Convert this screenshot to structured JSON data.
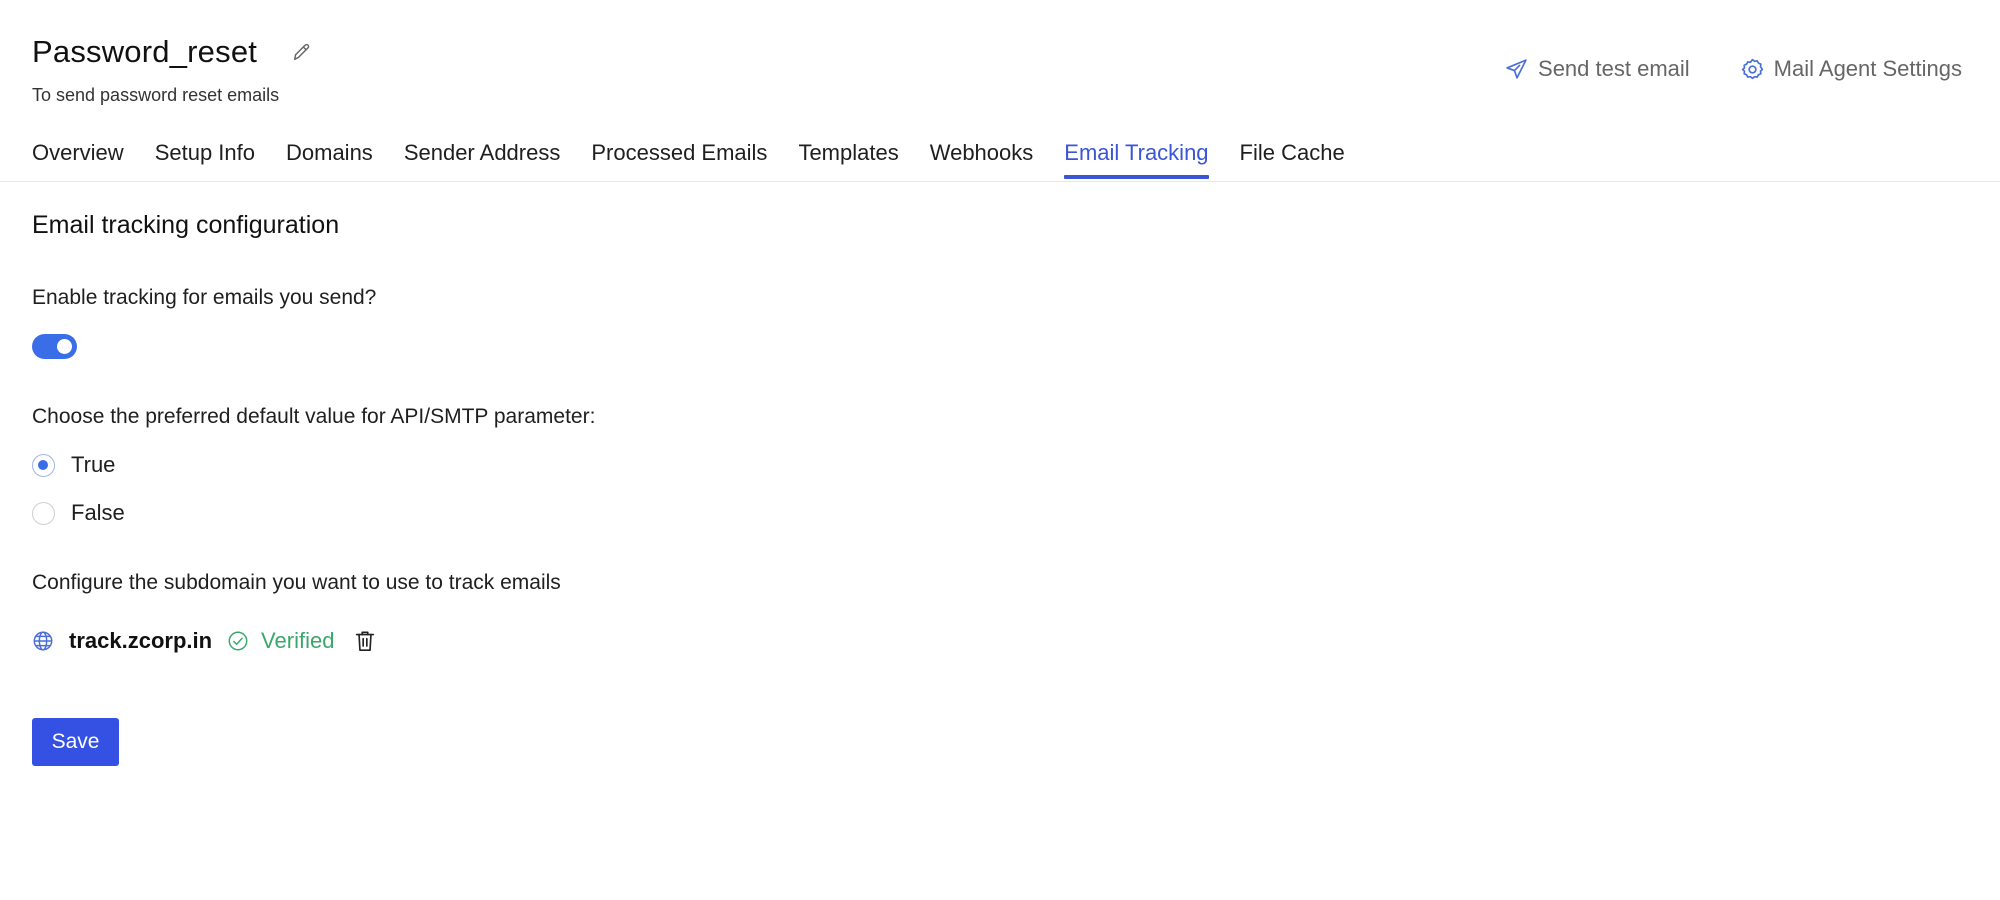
{
  "header": {
    "title": "Password_reset",
    "subtitle": "To send password reset emails",
    "actions": [
      {
        "label": "Send test email",
        "icon": "paper-plane-icon"
      },
      {
        "label": "Mail Agent Settings",
        "icon": "gear-icon"
      }
    ]
  },
  "tabs": [
    {
      "label": "Overview",
      "active": false
    },
    {
      "label": "Setup Info",
      "active": false
    },
    {
      "label": "Domains",
      "active": false
    },
    {
      "label": "Sender Address",
      "active": false
    },
    {
      "label": "Processed Emails",
      "active": false
    },
    {
      "label": "Templates",
      "active": false
    },
    {
      "label": "Webhooks",
      "active": false
    },
    {
      "label": "Email Tracking",
      "active": true
    },
    {
      "label": "File Cache",
      "active": false
    }
  ],
  "tracking": {
    "section_title": "Email tracking configuration",
    "enable_question": "Enable tracking for emails you send?",
    "enabled": true,
    "default_value_question": "Choose the preferred default value for API/SMTP parameter:",
    "options": [
      {
        "label": "True",
        "selected": true
      },
      {
        "label": "False",
        "selected": false
      }
    ],
    "subdomain_question": "Configure the subdomain you want to use to track emails",
    "subdomain": {
      "name": "track.zcorp.in",
      "status": "Verified"
    }
  },
  "save_label": "Save",
  "colors": {
    "accent": "#3a55d6",
    "primary_button": "#3451e3",
    "toggle_on": "#3a6ee8",
    "verified": "#3aa86b"
  }
}
